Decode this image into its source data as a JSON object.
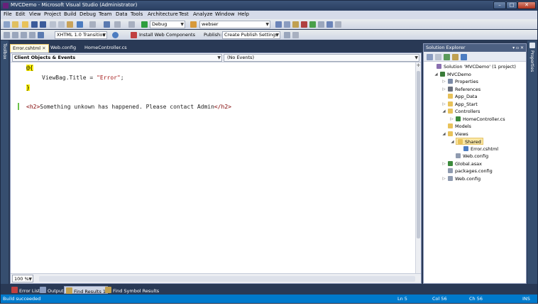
{
  "window": {
    "title": "MVCDemo - Microsoft Visual Studio (Administrator)",
    "caption_buttons": [
      "–",
      "□",
      "✕"
    ]
  },
  "menu": [
    "File",
    "Edit",
    "View",
    "Project",
    "Build",
    "Debug",
    "Team",
    "Data",
    "Tools",
    "Architecture",
    "Test",
    "Analyze",
    "Window",
    "Help"
  ],
  "toolbar1": {
    "config": "Debug",
    "search_combo": "webser"
  },
  "toolbar2": {
    "doctype": "XHTML 1.0 Transition",
    "install_web_components": "Install Web Components",
    "publish_label": "Publish:",
    "publish_profile": "Create Publish Settings"
  },
  "side_tabs": {
    "toolbox": "Toolbox",
    "properties": "Properties"
  },
  "doc_tabs": [
    {
      "label": "Error.cshtml",
      "active": true,
      "close": "✕"
    },
    {
      "label": "Web.config",
      "active": false
    },
    {
      "label": "HomeController.cs",
      "active": false
    }
  ],
  "editor": {
    "nav_left": "Client Objects & Events",
    "nav_right": "(No Events)",
    "code": {
      "l1_at": "@{",
      "l2_prefix": "ViewBag.Title = ",
      "l2_str": "\"Error\"",
      "l2_suffix": ";",
      "l3_brace": "}",
      "l5_open": "<h2>",
      "l5_text": "Something unkown has happened. Please contact Admin",
      "l5_close": "</h2>"
    },
    "zoom": "100 %"
  },
  "solution_explorer": {
    "title": "Solution Explorer",
    "header_buttons": "▾ ▫ ✕",
    "items": [
      {
        "label": "Solution 'MVCDemo' (1 project)",
        "icon": "solution-icon",
        "color": "#8a6fb0"
      },
      {
        "label": "MVCDemo",
        "icon": "project-icon",
        "color": "#3a7c3a",
        "expander": "◢"
      },
      {
        "label": "Properties",
        "icon": "properties-icon",
        "color": "#7b8aa6",
        "expander": "▷"
      },
      {
        "label": "References",
        "icon": "references-icon",
        "color": "#6a6f7c",
        "expander": "▷"
      },
      {
        "label": "App_Data",
        "icon": "folder-icon",
        "color": "#e8c25a"
      },
      {
        "label": "App_Start",
        "icon": "folder-icon",
        "color": "#e8c25a",
        "expander": "▷"
      },
      {
        "label": "Controllers",
        "icon": "folder-icon",
        "color": "#e8c25a",
        "expander": "◢"
      },
      {
        "label": "HomeController.cs",
        "icon": "csharp-file-icon",
        "color": "#3c8a3c",
        "expander": "▷"
      },
      {
        "label": "Models",
        "icon": "folder-icon",
        "color": "#e8c25a"
      },
      {
        "label": "Views",
        "icon": "folder-icon",
        "color": "#e8c25a",
        "expander": "◢"
      },
      {
        "label": "Shared",
        "icon": "folder-open-icon",
        "color": "#e8c25a",
        "expander": "◢",
        "selected": true
      },
      {
        "label": "Error.cshtml",
        "icon": "cshtml-file-icon",
        "color": "#4b7cc2"
      },
      {
        "label": "Web.config",
        "icon": "config-file-icon",
        "color": "#8f9bb0"
      },
      {
        "label": "Global.asax",
        "icon": "asax-file-icon",
        "color": "#3c8a3c",
        "expander": "▷"
      },
      {
        "label": "packages.config",
        "icon": "config-file-icon",
        "color": "#8f9bb0"
      },
      {
        "label": "Web.config",
        "icon": "config-file-icon",
        "color": "#8f9bb0",
        "expander": "▷"
      }
    ]
  },
  "bottom_tabs": [
    {
      "label": "Error List",
      "icon": "error-list-icon",
      "active": false
    },
    {
      "label": "Output",
      "icon": "output-icon",
      "active": false
    },
    {
      "label": "Find Results 1",
      "icon": "find-results-icon",
      "active": true
    },
    {
      "label": "Find Symbol Results",
      "icon": "find-symbol-icon",
      "active": false
    }
  ],
  "status": {
    "message": "Build succeeded",
    "line": "Ln 5",
    "col": "Col 56",
    "ch": "Ch 56",
    "mode": "INS"
  },
  "colors": {
    "chrome": "#293955",
    "caret_highlight": "#fff100",
    "change_bar": "#6cc24a",
    "status_bar": "#007acc"
  }
}
